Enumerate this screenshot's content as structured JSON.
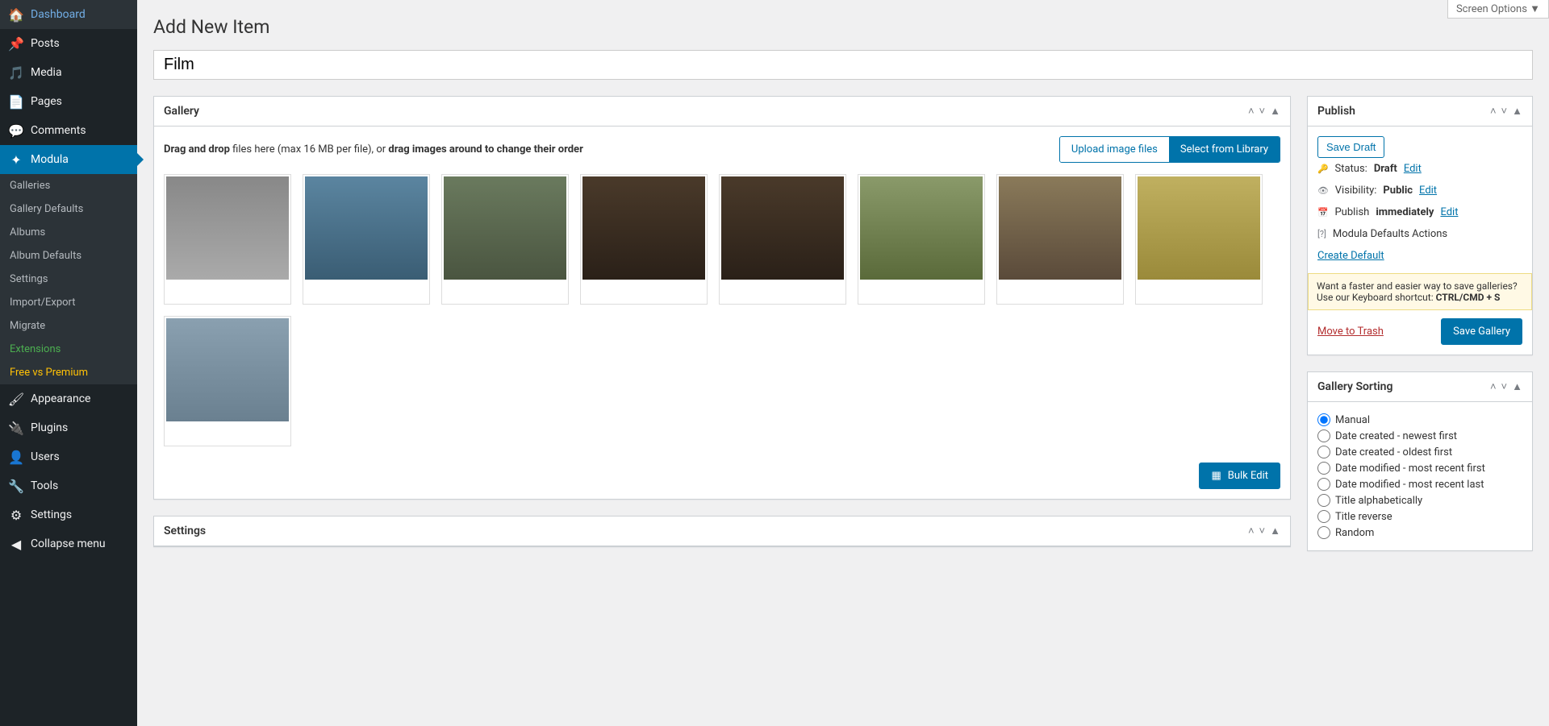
{
  "screen_options": "Screen Options ▼",
  "page_title": "Add New Item",
  "title_value": "Film",
  "sidebar": {
    "items": [
      {
        "label": "Dashboard",
        "icon": "⌂"
      },
      {
        "label": "Posts",
        "icon": "📌"
      },
      {
        "label": "Media",
        "icon": "🖼"
      },
      {
        "label": "Pages",
        "icon": "📄"
      },
      {
        "label": "Comments",
        "icon": "💬"
      },
      {
        "label": "Modula",
        "icon": "⚙"
      },
      {
        "label": "Appearance",
        "icon": "🖌"
      },
      {
        "label": "Plugins",
        "icon": "🔌"
      },
      {
        "label": "Users",
        "icon": "👤"
      },
      {
        "label": "Tools",
        "icon": "🔧"
      },
      {
        "label": "Settings",
        "icon": "⚒"
      },
      {
        "label": "Collapse menu",
        "icon": "◀"
      }
    ],
    "submenu": [
      "Galleries",
      "Gallery Defaults",
      "Albums",
      "Album Defaults",
      "Settings",
      "Import/Export",
      "Migrate",
      "Extensions",
      "Free vs Premium"
    ]
  },
  "gallery_box": {
    "title": "Gallery",
    "drag_prefix": "Drag and drop",
    "drag_mid": " files here (max 16 MB per file), or ",
    "drag_suffix": "drag images around to change their order",
    "upload_btn": "Upload image files",
    "library_btn": "Select from Library",
    "bulk_edit": "Bulk Edit"
  },
  "settings_box": {
    "title": "Settings"
  },
  "publish": {
    "title": "Publish",
    "save_draft": "Save Draft",
    "status_label": "Status:",
    "status_value": "Draft",
    "visibility_label": "Visibility:",
    "visibility_value": "Public",
    "publish_label": "Publish",
    "publish_value": "immediately",
    "edit": "Edit",
    "defaults_label": "Modula Defaults Actions",
    "create_default": "Create Default",
    "hint_text": "Want a faster and easier way to save galleries? Use our Keyboard shortcut: ",
    "hint_key": "CTRL/CMD + S",
    "trash": "Move to Trash",
    "save_gallery": "Save Gallery"
  },
  "sorting": {
    "title": "Gallery Sorting",
    "options": [
      "Manual",
      "Date created - newest first",
      "Date created - oldest first",
      "Date modified - most recent first",
      "Date modified - most recent last",
      "Title alphabetically",
      "Title reverse",
      "Random"
    ]
  }
}
